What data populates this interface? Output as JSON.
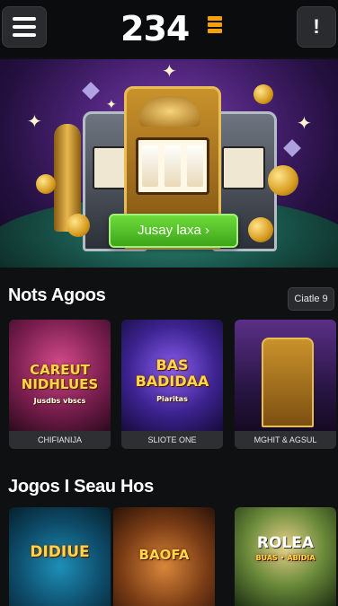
{
  "header": {
    "logo_text": "234",
    "menu_icon": "hamburger-menu-icon",
    "info_label": "!"
  },
  "hero": {
    "play_button_label": "Jusay laxa ›"
  },
  "section1": {
    "title": "Nots Agoos",
    "see_all_label": "Ciatle 9",
    "cards": [
      {
        "art_text": "CAREUT NIDHLUES",
        "art_sub": "Jusdbs vbscs",
        "caption": "CHIFIANIJA"
      },
      {
        "art_text": "BAS BADIDAA",
        "art_sub": "Piaritas",
        "caption": "SLIOTE ONE"
      },
      {
        "art_text": "",
        "art_sub": "",
        "caption": "MGHIT & AGSUL"
      }
    ]
  },
  "section2": {
    "title": "Jogos I Seau Hos",
    "cards": [
      {
        "art_text": "DIDIUE"
      },
      {
        "art_text": "BAOFA"
      },
      {
        "art_text": "ROLEA",
        "art_sub": "BUAS • ABIDIA"
      }
    ]
  },
  "colors": {
    "background": "#0f1012",
    "accent_green": "#4cbf22",
    "logo_accent": "#f5a10b"
  }
}
